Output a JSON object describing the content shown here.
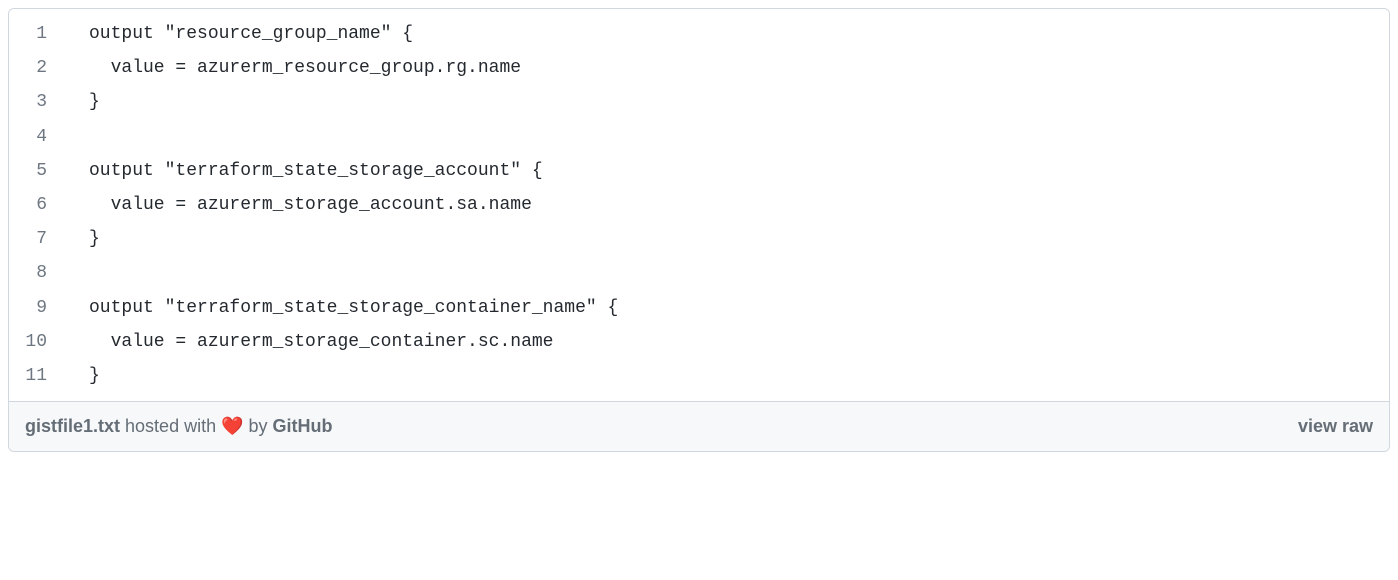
{
  "code": {
    "lines": [
      {
        "num": "1",
        "text": "output \"resource_group_name\" {"
      },
      {
        "num": "2",
        "text": "  value = azurerm_resource_group.rg.name"
      },
      {
        "num": "3",
        "text": "}"
      },
      {
        "num": "4",
        "text": ""
      },
      {
        "num": "5",
        "text": "output \"terraform_state_storage_account\" {"
      },
      {
        "num": "6",
        "text": "  value = azurerm_storage_account.sa.name"
      },
      {
        "num": "7",
        "text": "}"
      },
      {
        "num": "8",
        "text": ""
      },
      {
        "num": "9",
        "text": "output \"terraform_state_storage_container_name\" {"
      },
      {
        "num": "10",
        "text": "  value = azurerm_storage_container.sc.name"
      },
      {
        "num": "11",
        "text": "}"
      }
    ]
  },
  "footer": {
    "filename": "gistfile1.txt",
    "hosted_with": "hosted with",
    "heart": "❤️",
    "by": "by",
    "github": "GitHub",
    "view_raw": "view raw"
  }
}
